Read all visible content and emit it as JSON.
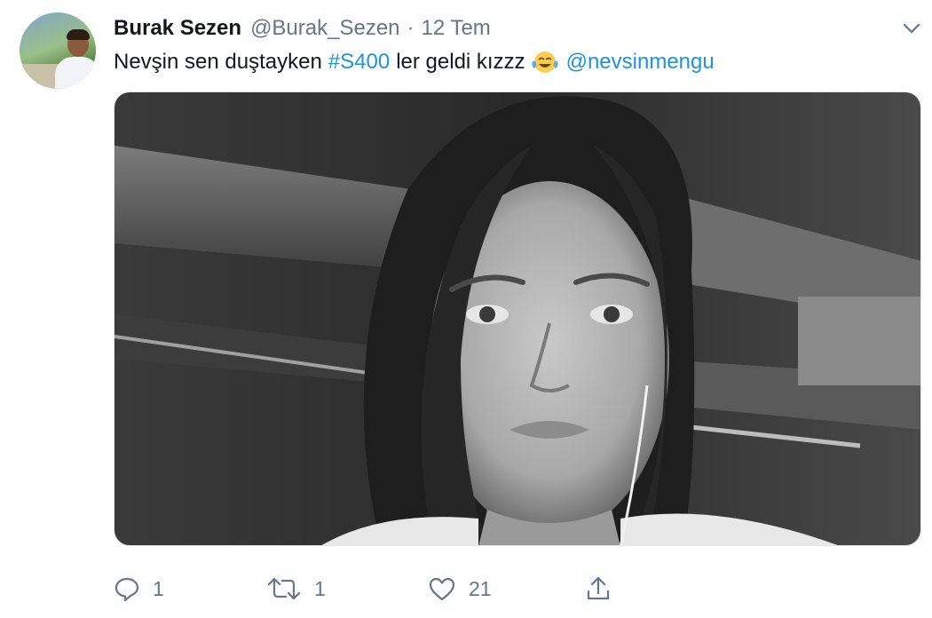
{
  "tweet": {
    "author_name": "Burak Sezen",
    "author_handle": "@Burak_Sezen",
    "separator": "·",
    "date": "12 Tem",
    "text": {
      "part1": "Nevşin sen duştayken",
      "hashtag": "#S400",
      "part2": "ler geldi kızzz",
      "emoji": "face-with-tears-of-joy",
      "mention": "@nevsinmengu"
    },
    "media": {
      "type": "photo",
      "style": "black-and-white"
    },
    "actions": {
      "reply_count": "1",
      "retweet_count": "1",
      "like_count": "21"
    },
    "icons": {
      "menu": "chevron-down-icon",
      "reply": "reply-icon",
      "retweet": "retweet-icon",
      "like": "heart-icon",
      "share": "share-icon"
    }
  },
  "colors": {
    "text": "#14171a",
    "secondary": "#657786",
    "link": "#1b95e0",
    "background": "#ffffff",
    "border": "#e1e8ed"
  }
}
